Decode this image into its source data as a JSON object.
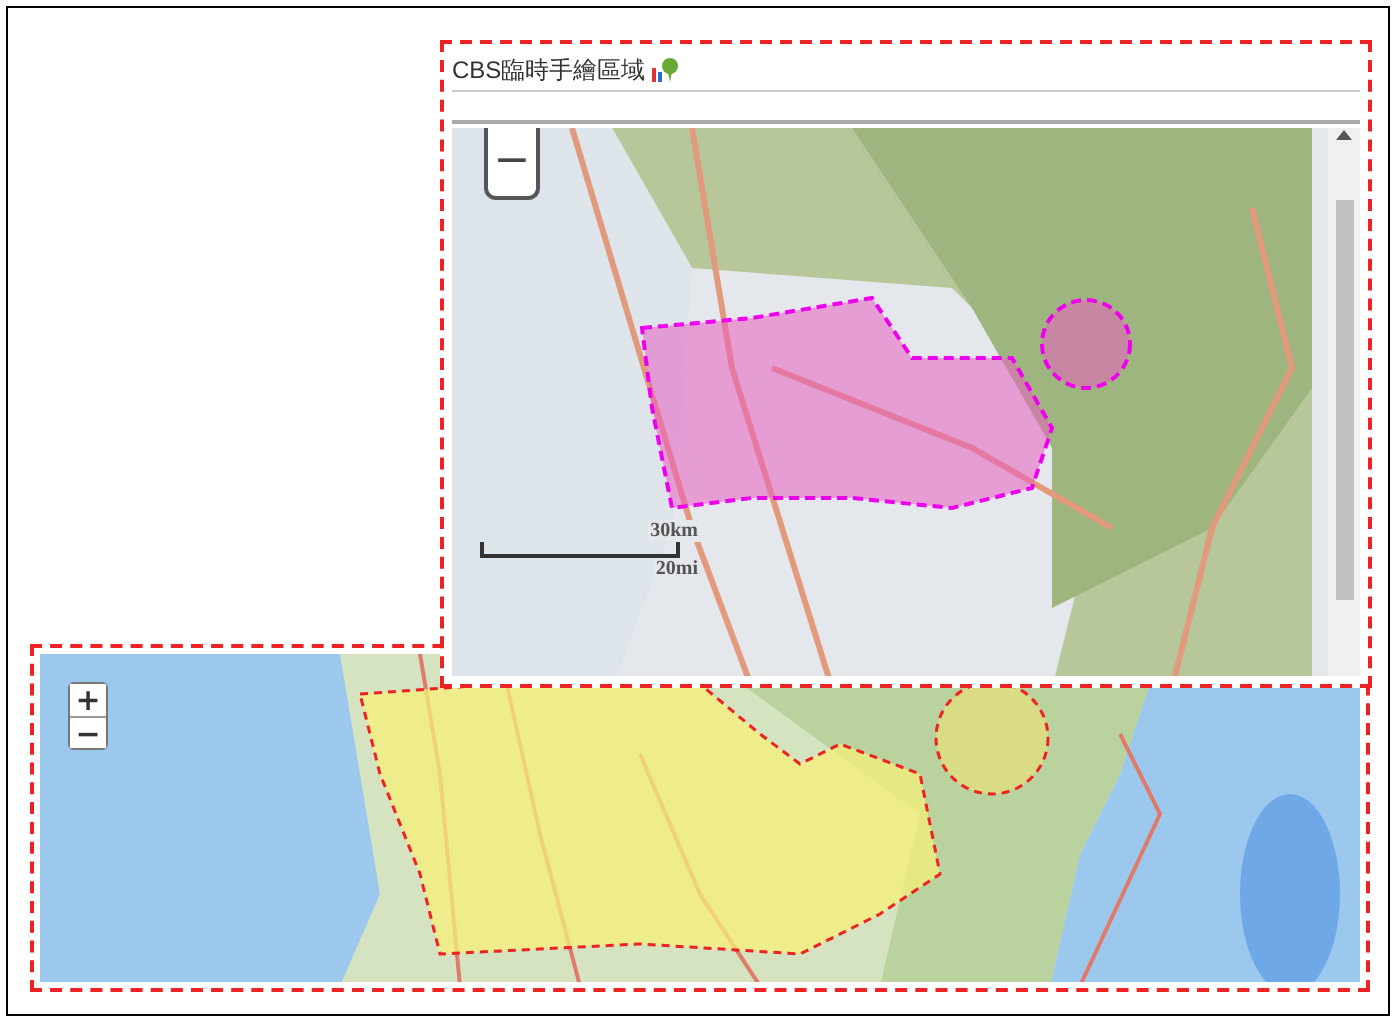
{
  "panel": {
    "title": "CBS臨時手繪區域",
    "map": {
      "zoom_out": "−",
      "scale": {
        "metric": "30km",
        "imperial": "20mi"
      }
    }
  },
  "overview_map": {
    "zoom_in": "+",
    "zoom_out": "−"
  }
}
